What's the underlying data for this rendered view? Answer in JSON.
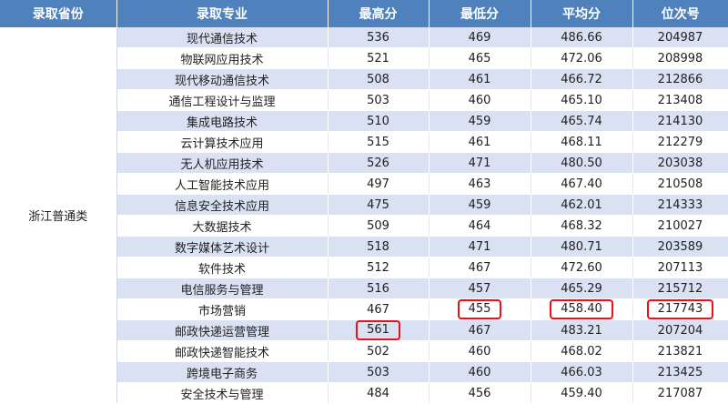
{
  "table": {
    "headers": [
      "录取省份",
      "录取专业",
      "最高分",
      "最低分",
      "平均分",
      "位次号"
    ],
    "province": "浙江普通类",
    "rows": [
      {
        "major": "现代通信技术",
        "max": "536",
        "min": "469",
        "avg": "486.66",
        "rank": "204987"
      },
      {
        "major": "物联网应用技术",
        "max": "521",
        "min": "465",
        "avg": "472.06",
        "rank": "208998"
      },
      {
        "major": "现代移动通信技术",
        "max": "508",
        "min": "461",
        "avg": "466.72",
        "rank": "212866"
      },
      {
        "major": "通信工程设计与监理",
        "max": "503",
        "min": "460",
        "avg": "465.10",
        "rank": "213408"
      },
      {
        "major": "集成电路技术",
        "max": "510",
        "min": "459",
        "avg": "465.74",
        "rank": "214130"
      },
      {
        "major": "云计算技术应用",
        "max": "515",
        "min": "461",
        "avg": "468.11",
        "rank": "212279"
      },
      {
        "major": "无人机应用技术",
        "max": "526",
        "min": "471",
        "avg": "480.50",
        "rank": "203038"
      },
      {
        "major": "人工智能技术应用",
        "max": "497",
        "min": "463",
        "avg": "467.40",
        "rank": "210508"
      },
      {
        "major": "信息安全技术应用",
        "max": "475",
        "min": "459",
        "avg": "462.01",
        "rank": "214333"
      },
      {
        "major": "大数据技术",
        "max": "509",
        "min": "464",
        "avg": "468.32",
        "rank": "210027"
      },
      {
        "major": "数字媒体艺术设计",
        "max": "518",
        "min": "471",
        "avg": "480.71",
        "rank": "203589"
      },
      {
        "major": "软件技术",
        "max": "512",
        "min": "467",
        "avg": "472.60",
        "rank": "207113"
      },
      {
        "major": "电信服务与管理",
        "max": "516",
        "min": "457",
        "avg": "465.29",
        "rank": "215712"
      },
      {
        "major": "市场营销",
        "max": "467",
        "min": "455",
        "avg": "458.40",
        "rank": "217743"
      },
      {
        "major": "邮政快递运营管理",
        "max": "561",
        "min": "467",
        "avg": "483.21",
        "rank": "207204"
      },
      {
        "major": "邮政快递智能技术",
        "max": "502",
        "min": "460",
        "avg": "468.02",
        "rank": "213821"
      },
      {
        "major": "跨境电子商务",
        "max": "503",
        "min": "460",
        "avg": "466.03",
        "rank": "213425"
      },
      {
        "major": "安全技术与管理",
        "max": "484",
        "min": "456",
        "avg": "459.40",
        "rank": "217087"
      }
    ],
    "highlights": [
      {
        "row": 13,
        "field": "min"
      },
      {
        "row": 13,
        "field": "avg"
      },
      {
        "row": 13,
        "field": "rank"
      },
      {
        "row": 14,
        "field": "max"
      }
    ],
    "highlight_color": "#e8101a",
    "header_color": "#4f81bd",
    "stripe_color": "#d9e1f2"
  }
}
